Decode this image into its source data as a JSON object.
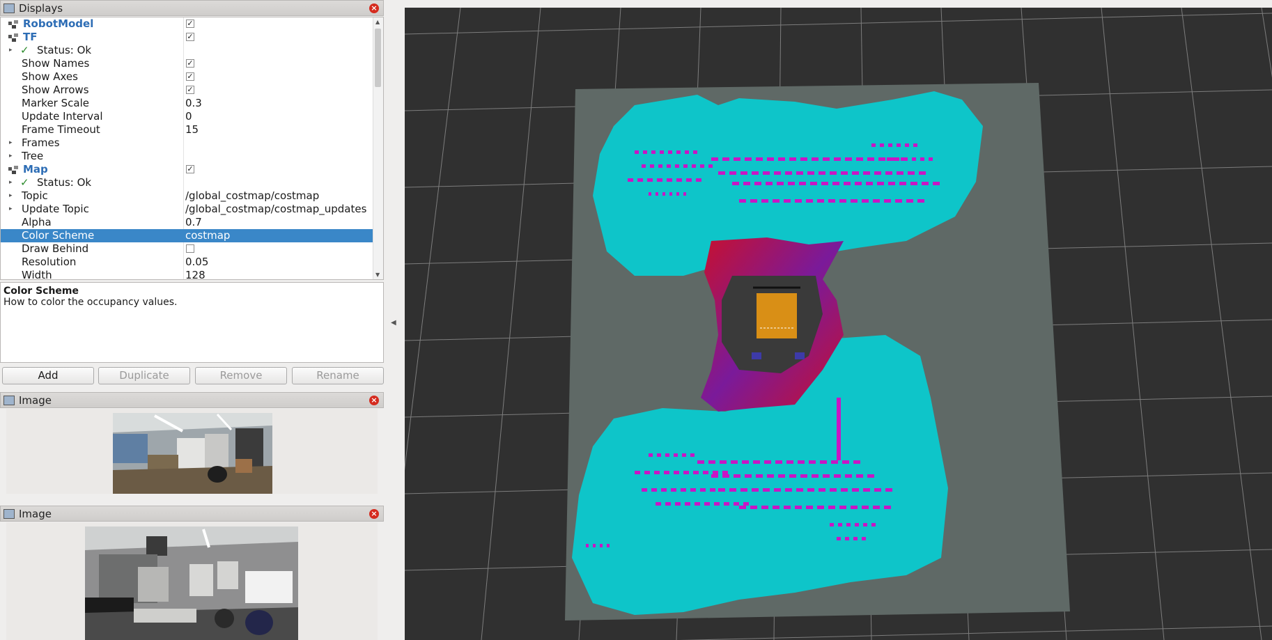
{
  "displays_panel": {
    "title": "Displays",
    "rows": [
      {
        "label": "RobotModel",
        "checked": true,
        "kind": "display"
      },
      {
        "label": "TF",
        "checked": true,
        "kind": "display"
      },
      {
        "label": "Status: Ok",
        "kind": "status"
      },
      {
        "label": "Show Names",
        "checked": true
      },
      {
        "label": "Show Axes",
        "checked": true
      },
      {
        "label": "Show Arrows",
        "checked": true
      },
      {
        "label": "Marker Scale",
        "value": "0.3"
      },
      {
        "label": "Update Interval",
        "value": "0"
      },
      {
        "label": "Frame Timeout",
        "value": "15"
      },
      {
        "label": "Frames",
        "expandable": true
      },
      {
        "label": "Tree",
        "expandable": true
      },
      {
        "label": "Map",
        "checked": true,
        "kind": "display"
      },
      {
        "label": "Status: Ok",
        "kind": "status"
      },
      {
        "label": "Topic",
        "value": "/global_costmap/costmap",
        "expandable": true
      },
      {
        "label": "Update Topic",
        "value": "/global_costmap/costmap_updates",
        "expandable": true
      },
      {
        "label": "Alpha",
        "value": "0.7"
      },
      {
        "label": "Color Scheme",
        "value": "costmap",
        "selected": true
      },
      {
        "label": "Draw Behind",
        "checked": false
      },
      {
        "label": "Resolution",
        "value": "0.05"
      },
      {
        "label": "Width",
        "value": "128"
      }
    ],
    "description_title": "Color Scheme",
    "description_text": "How to color the occupancy values.",
    "buttons": [
      {
        "label": "Add",
        "enabled": true
      },
      {
        "label": "Duplicate",
        "enabled": false
      },
      {
        "label": "Remove",
        "enabled": false
      },
      {
        "label": "Rename",
        "enabled": false
      }
    ]
  },
  "image_panel_1": {
    "title": "Image"
  },
  "image_panel_2": {
    "title": "Image"
  },
  "checkmark_glyph": "✓",
  "colors": {
    "selection": "#3a87c8",
    "viewport_bg": "#303030",
    "grid_line": "#7d7d7d",
    "map_free": "#5f6966",
    "inflation": "#0ec5c9",
    "lethal": "#c816c4",
    "gradient_red": "#c8102e",
    "robot_body": "#d98f16"
  }
}
